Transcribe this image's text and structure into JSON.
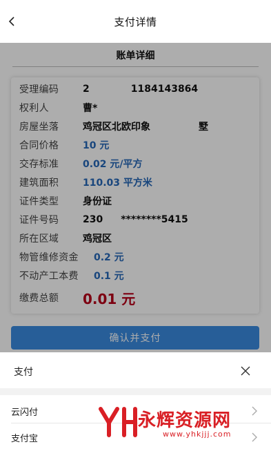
{
  "nav": {
    "title": "支付详情"
  },
  "section": {
    "title": "账单详细"
  },
  "details": [
    {
      "label": "受理编码",
      "value": "2",
      "value_tail": "1184143864",
      "style": "normal"
    },
    {
      "label": "权利人",
      "value": "曹*",
      "style": "normal"
    },
    {
      "label": "房屋坐落",
      "value": "鸡冠区北欧印象",
      "value_tail": "墅",
      "style": "normal"
    },
    {
      "label": "合同价格",
      "value": "10 元",
      "style": "blue"
    },
    {
      "label": "交存标准",
      "value": "0.02 元/平方",
      "style": "blue"
    },
    {
      "label": "建筑面积",
      "value": "110.03 平方米",
      "style": "blue"
    },
    {
      "label": "证件类型",
      "value": "身份证",
      "style": "normal"
    },
    {
      "label": "证件号码",
      "value": "230",
      "value_tail": "********5415",
      "style": "normal"
    },
    {
      "label": "所在区域",
      "value": "鸡冠区",
      "style": "normal"
    },
    {
      "label": "物管维修资金",
      "value": "0.2 元",
      "style": "blue"
    },
    {
      "label": "不动产工本费",
      "value": "0.1 元",
      "style": "blue"
    },
    {
      "label": "缴费总额",
      "value": "0.01 元",
      "style": "red"
    }
  ],
  "confirm_button": {
    "label": "确认并支付"
  },
  "sheet": {
    "title": "支付",
    "options": [
      {
        "label": "云闪付"
      },
      {
        "label": "支付宝"
      }
    ]
  },
  "watermark": {
    "text": "永辉资源网",
    "url": "www.yhkjjj.com"
  },
  "colors": {
    "accent_blue": "#3a8be0",
    "value_blue": "#2668b8",
    "total_red": "#b8001a",
    "watermark_red": "#d8141a"
  },
  "icons": {
    "back": "chevron-left-icon",
    "close": "close-icon",
    "arrow": "chevron-right-icon"
  }
}
